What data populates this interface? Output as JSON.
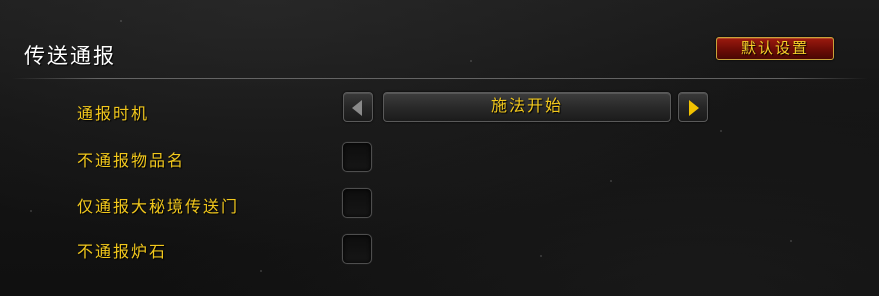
{
  "panel": {
    "title": "传送通报",
    "defaults_button": "默认设置"
  },
  "options": {
    "announce_timing": {
      "label": "通报时机",
      "selected_value": "施法开始"
    },
    "no_item_name": {
      "label": "不通报物品名",
      "checked": false
    },
    "only_mythic_portal": {
      "label": "仅通报大秘境传送门",
      "checked": false
    },
    "no_hearthstone": {
      "label": "不通报炉石",
      "checked": false
    }
  },
  "colors": {
    "label_gold": "#f2c81c",
    "button_red": "#8a140a",
    "title_white": "#ffffff",
    "arrow_active": "#f2c200",
    "arrow_inactive": "#8a8a8a"
  },
  "icons": {
    "prev": "left-arrow-icon",
    "next": "right-arrow-icon"
  }
}
